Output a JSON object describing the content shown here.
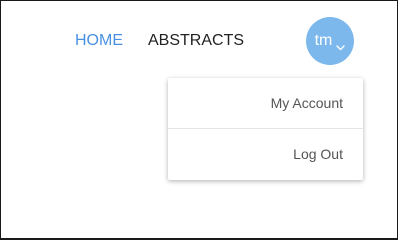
{
  "nav": {
    "home_label": "HOME",
    "abstracts_label": "ABSTRACTS"
  },
  "user": {
    "initials": "tm"
  },
  "menu": {
    "items": [
      {
        "label": "My Account"
      },
      {
        "label": "Log Out"
      }
    ]
  },
  "colors": {
    "accent": "#4a90e2",
    "avatar_bg": "#7cb8ec",
    "text": "#222222",
    "text_secondary": "#555555"
  },
  "icons": {
    "avatar_dropdown": "chevron-down-icon"
  }
}
